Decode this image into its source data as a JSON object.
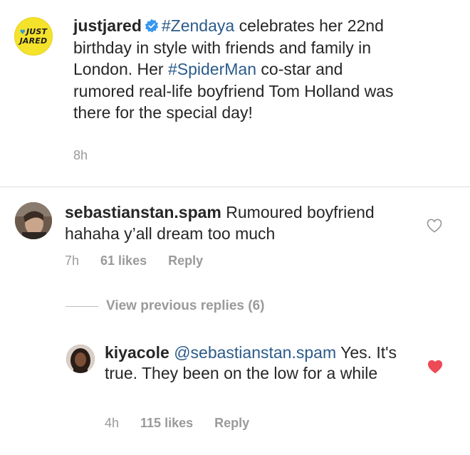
{
  "caption": {
    "logo_text_line1": "JUST",
    "logo_text_line2": "JARED",
    "username": "justjared",
    "segments": {
      "hashtag1": "#Zendaya",
      "text1": " celebrates her 22nd birthday in style with friends and family in London. Her ",
      "hashtag2": "#SpiderMan",
      "text2": " co-star and rumored real-life boyfriend Tom Holland was there for the special day!"
    },
    "time": "8h",
    "verified_color": "#3897f0"
  },
  "comment": {
    "username": "sebastianstan.spam",
    "text": " Rumoured boyfriend hahaha y’all dream too much",
    "time": "7h",
    "likes": "61 likes",
    "reply_label": "Reply",
    "liked": false
  },
  "view_replies": {
    "label": "View previous replies (6)"
  },
  "reply": {
    "username": "kiyacole",
    "mention": "@sebastianstan.spam",
    "text": " Yes. It's true. They been on the low for a while",
    "time": "4h",
    "likes": "115 likes",
    "reply_label": "Reply",
    "liked": true,
    "liked_color": "#ed4956"
  },
  "colors": {
    "link": "#2b5b8a",
    "meta": "#9a9a9a",
    "text": "#262626"
  }
}
